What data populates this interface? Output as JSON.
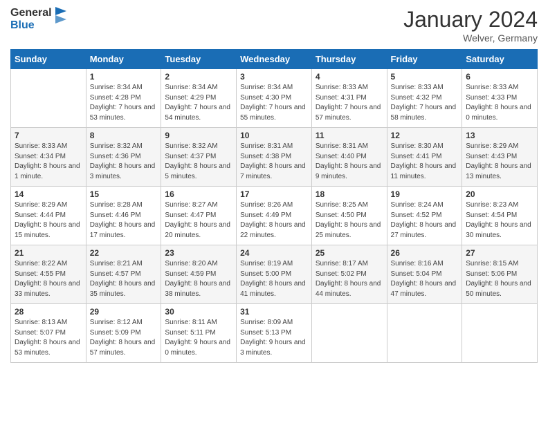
{
  "header": {
    "logo_line1": "General",
    "logo_line2": "Blue",
    "month": "January 2024",
    "location": "Welver, Germany"
  },
  "weekdays": [
    "Sunday",
    "Monday",
    "Tuesday",
    "Wednesday",
    "Thursday",
    "Friday",
    "Saturday"
  ],
  "weeks": [
    [
      {
        "day": "",
        "sunrise": "",
        "sunset": "",
        "daylight": ""
      },
      {
        "day": "1",
        "sunrise": "Sunrise: 8:34 AM",
        "sunset": "Sunset: 4:28 PM",
        "daylight": "Daylight: 7 hours and 53 minutes."
      },
      {
        "day": "2",
        "sunrise": "Sunrise: 8:34 AM",
        "sunset": "Sunset: 4:29 PM",
        "daylight": "Daylight: 7 hours and 54 minutes."
      },
      {
        "day": "3",
        "sunrise": "Sunrise: 8:34 AM",
        "sunset": "Sunset: 4:30 PM",
        "daylight": "Daylight: 7 hours and 55 minutes."
      },
      {
        "day": "4",
        "sunrise": "Sunrise: 8:33 AM",
        "sunset": "Sunset: 4:31 PM",
        "daylight": "Daylight: 7 hours and 57 minutes."
      },
      {
        "day": "5",
        "sunrise": "Sunrise: 8:33 AM",
        "sunset": "Sunset: 4:32 PM",
        "daylight": "Daylight: 7 hours and 58 minutes."
      },
      {
        "day": "6",
        "sunrise": "Sunrise: 8:33 AM",
        "sunset": "Sunset: 4:33 PM",
        "daylight": "Daylight: 8 hours and 0 minutes."
      }
    ],
    [
      {
        "day": "7",
        "sunrise": "Sunrise: 8:33 AM",
        "sunset": "Sunset: 4:34 PM",
        "daylight": "Daylight: 8 hours and 1 minute."
      },
      {
        "day": "8",
        "sunrise": "Sunrise: 8:32 AM",
        "sunset": "Sunset: 4:36 PM",
        "daylight": "Daylight: 8 hours and 3 minutes."
      },
      {
        "day": "9",
        "sunrise": "Sunrise: 8:32 AM",
        "sunset": "Sunset: 4:37 PM",
        "daylight": "Daylight: 8 hours and 5 minutes."
      },
      {
        "day": "10",
        "sunrise": "Sunrise: 8:31 AM",
        "sunset": "Sunset: 4:38 PM",
        "daylight": "Daylight: 8 hours and 7 minutes."
      },
      {
        "day": "11",
        "sunrise": "Sunrise: 8:31 AM",
        "sunset": "Sunset: 4:40 PM",
        "daylight": "Daylight: 8 hours and 9 minutes."
      },
      {
        "day": "12",
        "sunrise": "Sunrise: 8:30 AM",
        "sunset": "Sunset: 4:41 PM",
        "daylight": "Daylight: 8 hours and 11 minutes."
      },
      {
        "day": "13",
        "sunrise": "Sunrise: 8:29 AM",
        "sunset": "Sunset: 4:43 PM",
        "daylight": "Daylight: 8 hours and 13 minutes."
      }
    ],
    [
      {
        "day": "14",
        "sunrise": "Sunrise: 8:29 AM",
        "sunset": "Sunset: 4:44 PM",
        "daylight": "Daylight: 8 hours and 15 minutes."
      },
      {
        "day": "15",
        "sunrise": "Sunrise: 8:28 AM",
        "sunset": "Sunset: 4:46 PM",
        "daylight": "Daylight: 8 hours and 17 minutes."
      },
      {
        "day": "16",
        "sunrise": "Sunrise: 8:27 AM",
        "sunset": "Sunset: 4:47 PM",
        "daylight": "Daylight: 8 hours and 20 minutes."
      },
      {
        "day": "17",
        "sunrise": "Sunrise: 8:26 AM",
        "sunset": "Sunset: 4:49 PM",
        "daylight": "Daylight: 8 hours and 22 minutes."
      },
      {
        "day": "18",
        "sunrise": "Sunrise: 8:25 AM",
        "sunset": "Sunset: 4:50 PM",
        "daylight": "Daylight: 8 hours and 25 minutes."
      },
      {
        "day": "19",
        "sunrise": "Sunrise: 8:24 AM",
        "sunset": "Sunset: 4:52 PM",
        "daylight": "Daylight: 8 hours and 27 minutes."
      },
      {
        "day": "20",
        "sunrise": "Sunrise: 8:23 AM",
        "sunset": "Sunset: 4:54 PM",
        "daylight": "Daylight: 8 hours and 30 minutes."
      }
    ],
    [
      {
        "day": "21",
        "sunrise": "Sunrise: 8:22 AM",
        "sunset": "Sunset: 4:55 PM",
        "daylight": "Daylight: 8 hours and 33 minutes."
      },
      {
        "day": "22",
        "sunrise": "Sunrise: 8:21 AM",
        "sunset": "Sunset: 4:57 PM",
        "daylight": "Daylight: 8 hours and 35 minutes."
      },
      {
        "day": "23",
        "sunrise": "Sunrise: 8:20 AM",
        "sunset": "Sunset: 4:59 PM",
        "daylight": "Daylight: 8 hours and 38 minutes."
      },
      {
        "day": "24",
        "sunrise": "Sunrise: 8:19 AM",
        "sunset": "Sunset: 5:00 PM",
        "daylight": "Daylight: 8 hours and 41 minutes."
      },
      {
        "day": "25",
        "sunrise": "Sunrise: 8:17 AM",
        "sunset": "Sunset: 5:02 PM",
        "daylight": "Daylight: 8 hours and 44 minutes."
      },
      {
        "day": "26",
        "sunrise": "Sunrise: 8:16 AM",
        "sunset": "Sunset: 5:04 PM",
        "daylight": "Daylight: 8 hours and 47 minutes."
      },
      {
        "day": "27",
        "sunrise": "Sunrise: 8:15 AM",
        "sunset": "Sunset: 5:06 PM",
        "daylight": "Daylight: 8 hours and 50 minutes."
      }
    ],
    [
      {
        "day": "28",
        "sunrise": "Sunrise: 8:13 AM",
        "sunset": "Sunset: 5:07 PM",
        "daylight": "Daylight: 8 hours and 53 minutes."
      },
      {
        "day": "29",
        "sunrise": "Sunrise: 8:12 AM",
        "sunset": "Sunset: 5:09 PM",
        "daylight": "Daylight: 8 hours and 57 minutes."
      },
      {
        "day": "30",
        "sunrise": "Sunrise: 8:11 AM",
        "sunset": "Sunset: 5:11 PM",
        "daylight": "Daylight: 9 hours and 0 minutes."
      },
      {
        "day": "31",
        "sunrise": "Sunrise: 8:09 AM",
        "sunset": "Sunset: 5:13 PM",
        "daylight": "Daylight: 9 hours and 3 minutes."
      },
      {
        "day": "",
        "sunrise": "",
        "sunset": "",
        "daylight": ""
      },
      {
        "day": "",
        "sunrise": "",
        "sunset": "",
        "daylight": ""
      },
      {
        "day": "",
        "sunrise": "",
        "sunset": "",
        "daylight": ""
      }
    ]
  ]
}
